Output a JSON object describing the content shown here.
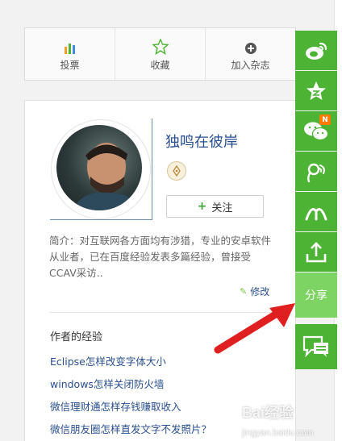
{
  "action_bar": {
    "items": [
      {
        "label": "投票",
        "icon": "bar-chart-icon"
      },
      {
        "label": "收藏",
        "icon": "star-icon"
      },
      {
        "label": "加入杂志",
        "icon": "plus-circle-icon"
      }
    ]
  },
  "profile": {
    "username": "独鸣在彼岸",
    "follow_label": "关注",
    "follow_icon": "+",
    "intro": "简介：对互联网各方面均有涉猎，专业的安卓软件从业者，已在百度经验发表多篇经验，曾接受CCAV采访..",
    "edit_label": "修改"
  },
  "experiences": {
    "title": "作者的经验",
    "items": [
      "Eclipse怎样改变字体大小",
      "windows怎样关闭防火墙",
      "微信理财通怎样存钱赚取收入",
      "微信朋友圈怎样直发文字不发照片？"
    ]
  },
  "sidebar": {
    "buttons": [
      {
        "icon": "weibo-icon"
      },
      {
        "icon": "qzone-star-icon"
      },
      {
        "icon": "wechat-icon",
        "badge": "N"
      },
      {
        "icon": "tencent-weibo-icon"
      },
      {
        "icon": "renren-icon"
      },
      {
        "icon": "share-upload-icon"
      }
    ],
    "share_label": "分享",
    "chat_icon": "comment-icon"
  },
  "watermark": {
    "brand": "Bai",
    "suffix": "经验",
    "sub": "jingyan.baidu.com"
  },
  "colors": {
    "accent_green": "#4db334",
    "share_green": "#7ed463",
    "link_blue": "#2a4f8e",
    "arrow_red": "#e02020"
  }
}
